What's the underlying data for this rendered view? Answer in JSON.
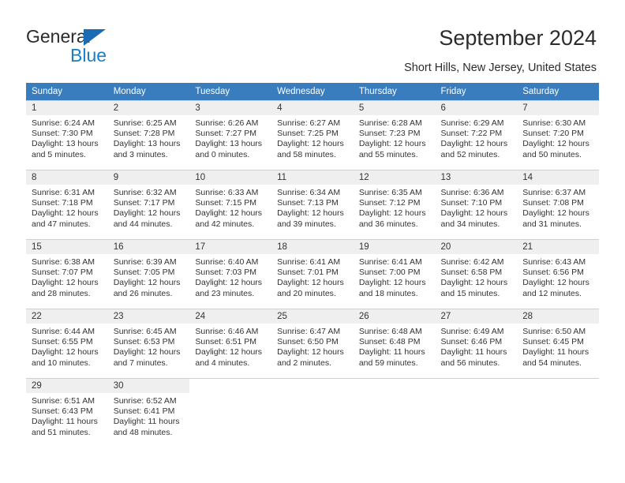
{
  "brand": {
    "name_top": "General",
    "name_bottom": "Blue",
    "triangle_color": "#1c6cb3",
    "blue_color": "#1b7ec4"
  },
  "header": {
    "title": "September 2024",
    "location": "Short Hills, New Jersey, United States",
    "header_bg": "#3a7dbf",
    "header_text_color": "#ffffff",
    "daynum_bg": "#efefef"
  },
  "weekdays": [
    "Sunday",
    "Monday",
    "Tuesday",
    "Wednesday",
    "Thursday",
    "Friday",
    "Saturday"
  ],
  "labels": {
    "sunrise_prefix": "Sunrise:",
    "sunset_prefix": "Sunset:",
    "daylight_prefix": "Daylight:"
  },
  "weeks": [
    [
      {
        "day": "1",
        "sunrise": "Sunrise: 6:24 AM",
        "sunset": "Sunset: 7:30 PM",
        "daylight1": "Daylight: 13 hours",
        "daylight2": "and 5 minutes."
      },
      {
        "day": "2",
        "sunrise": "Sunrise: 6:25 AM",
        "sunset": "Sunset: 7:28 PM",
        "daylight1": "Daylight: 13 hours",
        "daylight2": "and 3 minutes."
      },
      {
        "day": "3",
        "sunrise": "Sunrise: 6:26 AM",
        "sunset": "Sunset: 7:27 PM",
        "daylight1": "Daylight: 13 hours",
        "daylight2": "and 0 minutes."
      },
      {
        "day": "4",
        "sunrise": "Sunrise: 6:27 AM",
        "sunset": "Sunset: 7:25 PM",
        "daylight1": "Daylight: 12 hours",
        "daylight2": "and 58 minutes."
      },
      {
        "day": "5",
        "sunrise": "Sunrise: 6:28 AM",
        "sunset": "Sunset: 7:23 PM",
        "daylight1": "Daylight: 12 hours",
        "daylight2": "and 55 minutes."
      },
      {
        "day": "6",
        "sunrise": "Sunrise: 6:29 AM",
        "sunset": "Sunset: 7:22 PM",
        "daylight1": "Daylight: 12 hours",
        "daylight2": "and 52 minutes."
      },
      {
        "day": "7",
        "sunrise": "Sunrise: 6:30 AM",
        "sunset": "Sunset: 7:20 PM",
        "daylight1": "Daylight: 12 hours",
        "daylight2": "and 50 minutes."
      }
    ],
    [
      {
        "day": "8",
        "sunrise": "Sunrise: 6:31 AM",
        "sunset": "Sunset: 7:18 PM",
        "daylight1": "Daylight: 12 hours",
        "daylight2": "and 47 minutes."
      },
      {
        "day": "9",
        "sunrise": "Sunrise: 6:32 AM",
        "sunset": "Sunset: 7:17 PM",
        "daylight1": "Daylight: 12 hours",
        "daylight2": "and 44 minutes."
      },
      {
        "day": "10",
        "sunrise": "Sunrise: 6:33 AM",
        "sunset": "Sunset: 7:15 PM",
        "daylight1": "Daylight: 12 hours",
        "daylight2": "and 42 minutes."
      },
      {
        "day": "11",
        "sunrise": "Sunrise: 6:34 AM",
        "sunset": "Sunset: 7:13 PM",
        "daylight1": "Daylight: 12 hours",
        "daylight2": "and 39 minutes."
      },
      {
        "day": "12",
        "sunrise": "Sunrise: 6:35 AM",
        "sunset": "Sunset: 7:12 PM",
        "daylight1": "Daylight: 12 hours",
        "daylight2": "and 36 minutes."
      },
      {
        "day": "13",
        "sunrise": "Sunrise: 6:36 AM",
        "sunset": "Sunset: 7:10 PM",
        "daylight1": "Daylight: 12 hours",
        "daylight2": "and 34 minutes."
      },
      {
        "day": "14",
        "sunrise": "Sunrise: 6:37 AM",
        "sunset": "Sunset: 7:08 PM",
        "daylight1": "Daylight: 12 hours",
        "daylight2": "and 31 minutes."
      }
    ],
    [
      {
        "day": "15",
        "sunrise": "Sunrise: 6:38 AM",
        "sunset": "Sunset: 7:07 PM",
        "daylight1": "Daylight: 12 hours",
        "daylight2": "and 28 minutes."
      },
      {
        "day": "16",
        "sunrise": "Sunrise: 6:39 AM",
        "sunset": "Sunset: 7:05 PM",
        "daylight1": "Daylight: 12 hours",
        "daylight2": "and 26 minutes."
      },
      {
        "day": "17",
        "sunrise": "Sunrise: 6:40 AM",
        "sunset": "Sunset: 7:03 PM",
        "daylight1": "Daylight: 12 hours",
        "daylight2": "and 23 minutes."
      },
      {
        "day": "18",
        "sunrise": "Sunrise: 6:41 AM",
        "sunset": "Sunset: 7:01 PM",
        "daylight1": "Daylight: 12 hours",
        "daylight2": "and 20 minutes."
      },
      {
        "day": "19",
        "sunrise": "Sunrise: 6:41 AM",
        "sunset": "Sunset: 7:00 PM",
        "daylight1": "Daylight: 12 hours",
        "daylight2": "and 18 minutes."
      },
      {
        "day": "20",
        "sunrise": "Sunrise: 6:42 AM",
        "sunset": "Sunset: 6:58 PM",
        "daylight1": "Daylight: 12 hours",
        "daylight2": "and 15 minutes."
      },
      {
        "day": "21",
        "sunrise": "Sunrise: 6:43 AM",
        "sunset": "Sunset: 6:56 PM",
        "daylight1": "Daylight: 12 hours",
        "daylight2": "and 12 minutes."
      }
    ],
    [
      {
        "day": "22",
        "sunrise": "Sunrise: 6:44 AM",
        "sunset": "Sunset: 6:55 PM",
        "daylight1": "Daylight: 12 hours",
        "daylight2": "and 10 minutes."
      },
      {
        "day": "23",
        "sunrise": "Sunrise: 6:45 AM",
        "sunset": "Sunset: 6:53 PM",
        "daylight1": "Daylight: 12 hours",
        "daylight2": "and 7 minutes."
      },
      {
        "day": "24",
        "sunrise": "Sunrise: 6:46 AM",
        "sunset": "Sunset: 6:51 PM",
        "daylight1": "Daylight: 12 hours",
        "daylight2": "and 4 minutes."
      },
      {
        "day": "25",
        "sunrise": "Sunrise: 6:47 AM",
        "sunset": "Sunset: 6:50 PM",
        "daylight1": "Daylight: 12 hours",
        "daylight2": "and 2 minutes."
      },
      {
        "day": "26",
        "sunrise": "Sunrise: 6:48 AM",
        "sunset": "Sunset: 6:48 PM",
        "daylight1": "Daylight: 11 hours",
        "daylight2": "and 59 minutes."
      },
      {
        "day": "27",
        "sunrise": "Sunrise: 6:49 AM",
        "sunset": "Sunset: 6:46 PM",
        "daylight1": "Daylight: 11 hours",
        "daylight2": "and 56 minutes."
      },
      {
        "day": "28",
        "sunrise": "Sunrise: 6:50 AM",
        "sunset": "Sunset: 6:45 PM",
        "daylight1": "Daylight: 11 hours",
        "daylight2": "and 54 minutes."
      }
    ],
    [
      {
        "day": "29",
        "sunrise": "Sunrise: 6:51 AM",
        "sunset": "Sunset: 6:43 PM",
        "daylight1": "Daylight: 11 hours",
        "daylight2": "and 51 minutes."
      },
      {
        "day": "30",
        "sunrise": "Sunrise: 6:52 AM",
        "sunset": "Sunset: 6:41 PM",
        "daylight1": "Daylight: 11 hours",
        "daylight2": "and 48 minutes."
      },
      {
        "day": "",
        "sunrise": "",
        "sunset": "",
        "daylight1": "",
        "daylight2": ""
      },
      {
        "day": "",
        "sunrise": "",
        "sunset": "",
        "daylight1": "",
        "daylight2": ""
      },
      {
        "day": "",
        "sunrise": "",
        "sunset": "",
        "daylight1": "",
        "daylight2": ""
      },
      {
        "day": "",
        "sunrise": "",
        "sunset": "",
        "daylight1": "",
        "daylight2": ""
      },
      {
        "day": "",
        "sunrise": "",
        "sunset": "",
        "daylight1": "",
        "daylight2": ""
      }
    ]
  ]
}
